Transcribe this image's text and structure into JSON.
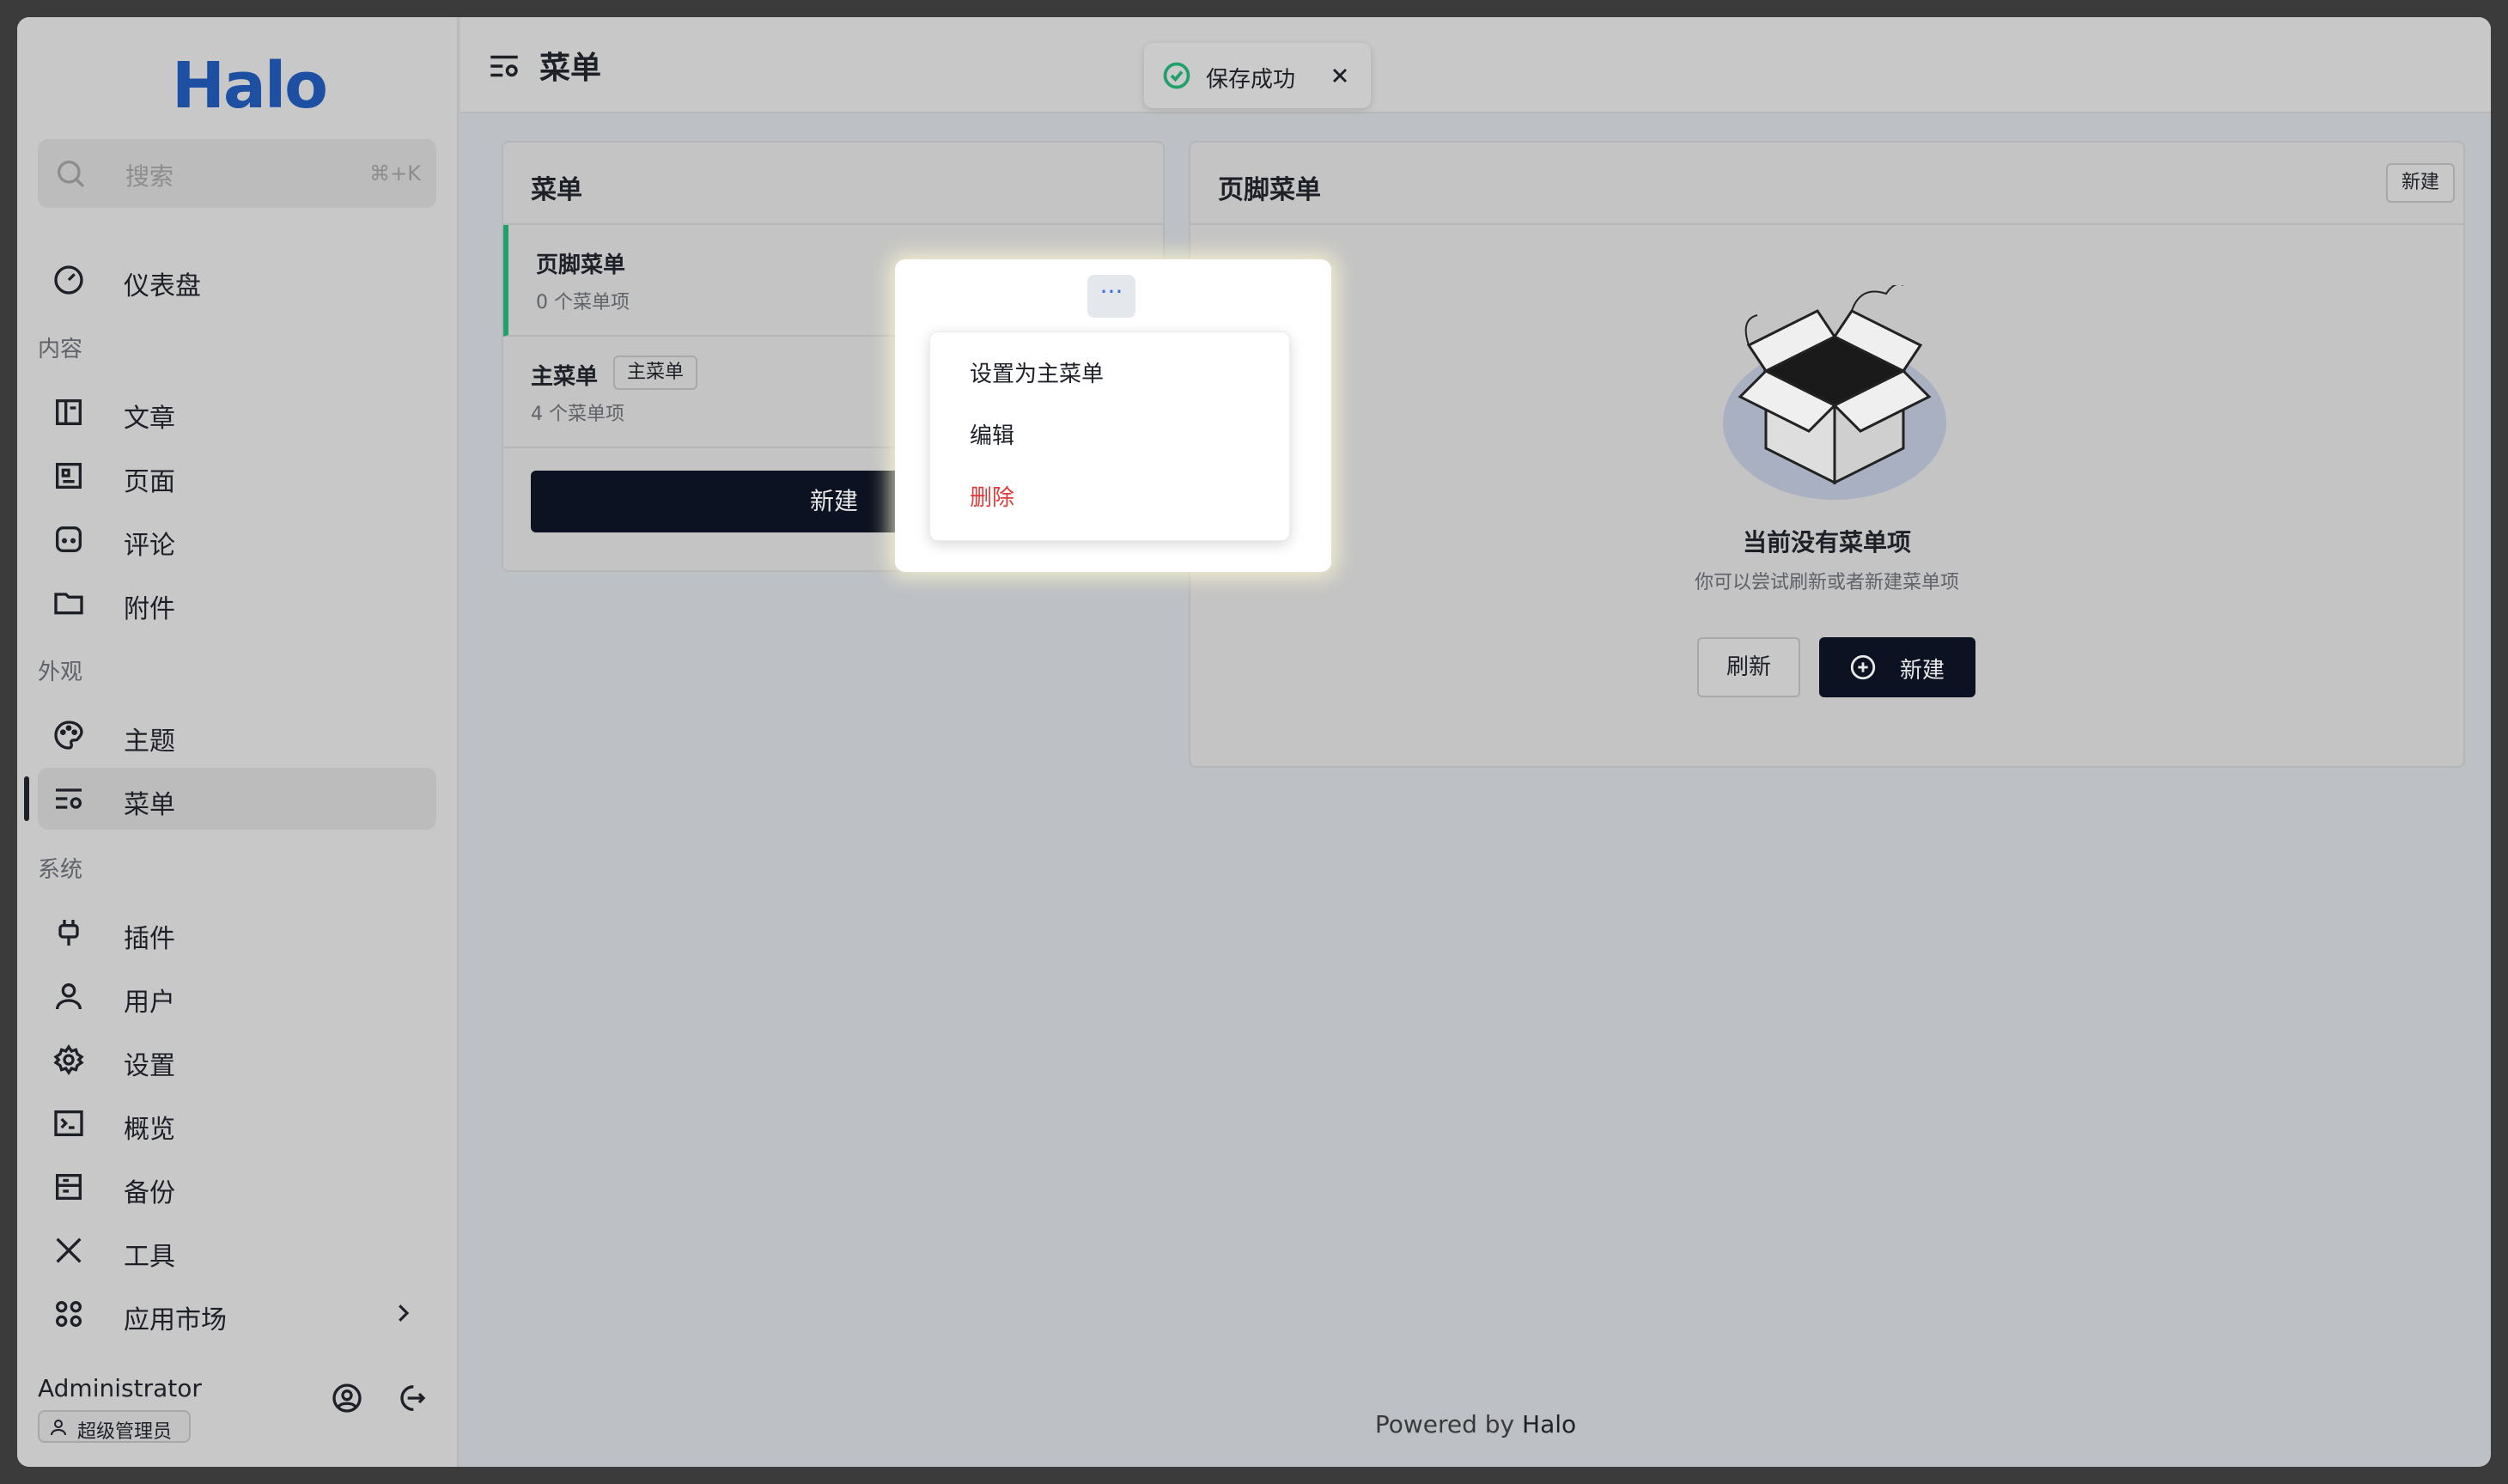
{
  "app": {
    "logo_text": "Halo",
    "brand_color": "#1d4fa3"
  },
  "search": {
    "placeholder": "搜索",
    "shortcut": "⌘+K"
  },
  "sidebar": {
    "dashboard": "仪表盘",
    "sections": {
      "content": "内容",
      "appearance": "外观",
      "system": "系统"
    },
    "content_items": [
      "文章",
      "页面",
      "评论",
      "附件"
    ],
    "appearance_items": [
      "主题",
      "菜单"
    ],
    "system_items": [
      "插件",
      "用户",
      "设置",
      "概览",
      "备份",
      "工具",
      "应用市场"
    ]
  },
  "user": {
    "name": "Administrator",
    "role": "超级管理员"
  },
  "header": {
    "title": "菜单"
  },
  "toast": {
    "message": "保存成功",
    "color": "#22a06b"
  },
  "menus_panel": {
    "title": "菜单",
    "items": [
      {
        "name": "页脚菜单",
        "count": "0 个菜单项"
      },
      {
        "name": "主菜单",
        "tag": "主菜单",
        "count": "4 个菜单项"
      }
    ],
    "new_button": "新建"
  },
  "dropdown": {
    "dots": "···",
    "items": [
      "设置为主菜单",
      "编辑",
      "删除"
    ],
    "danger_color": "#e03a3a"
  },
  "items_panel": {
    "title": "页脚菜单",
    "new_button": "新建",
    "empty_title": "当前没有菜单项",
    "empty_sub": "你可以尝试刷新或者新建菜单项",
    "refresh_button": "刷新",
    "create_button": "新建"
  },
  "footer": {
    "prefix": "Powered by",
    "brand": "Halo"
  }
}
